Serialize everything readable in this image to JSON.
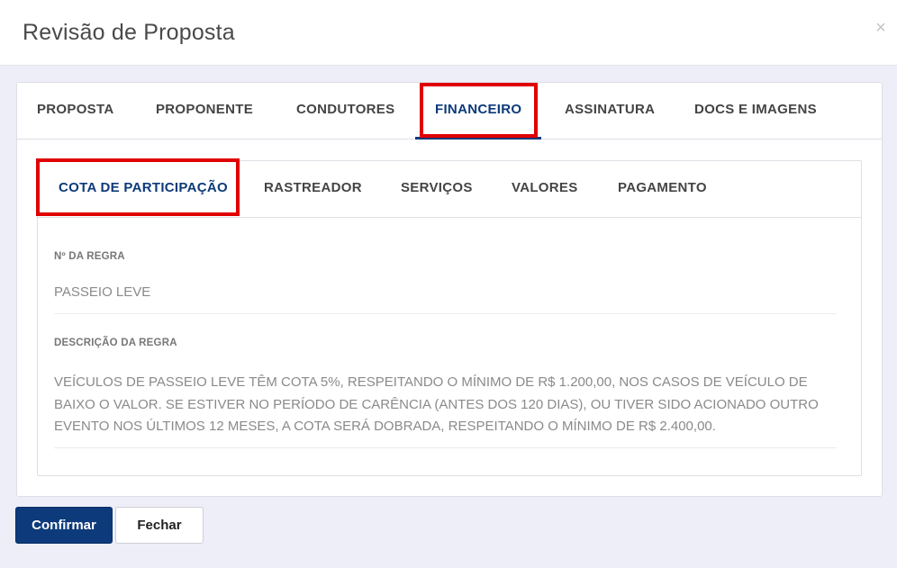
{
  "modal": {
    "title": "Revisão de Proposta",
    "close_label": "×"
  },
  "outer_tabs": [
    {
      "label": "PROPOSTA"
    },
    {
      "label": "PROPONENTE"
    },
    {
      "label": "CONDUTORES"
    },
    {
      "label": "FINANCEIRO",
      "active": true
    },
    {
      "label": "ASSINATURA"
    },
    {
      "label": "DOCS E IMAGENS"
    }
  ],
  "inner_tabs": [
    {
      "label": "COTA DE PARTICIPAÇÃO",
      "active": true
    },
    {
      "label": "RASTREADOR"
    },
    {
      "label": "SERVIÇOS"
    },
    {
      "label": "VALORES"
    },
    {
      "label": "PAGAMENTO"
    }
  ],
  "fields": {
    "rule_number": {
      "label": "Nº DA REGRA",
      "value": "PASSEIO LEVE"
    },
    "rule_description": {
      "label": "DESCRIÇÃO DA REGRA",
      "value": "VEÍCULOS DE PASSEIO LEVE TÊM COTA 5%, RESPEITANDO O MÍNIMO DE R$ 1.200,00, NOS CASOS DE VEÍCULO DE BAIXO O VALOR. SE ESTIVER NO PERÍODO DE CARÊNCIA (ANTES DOS 120 DIAS), OU TIVER SIDO ACIONADO OUTRO EVENTO NOS ÚLTIMOS 12 MESES, A COTA SERÁ DOBRADA, RESPEITANDO O MÍNIMO DE R$ 2.400,00."
    }
  },
  "footer": {
    "confirm_label": "Confirmar",
    "close_label": "Fechar"
  },
  "colors": {
    "primary": "#0d3a7a",
    "highlight": "#e00000",
    "backdrop": "#eeeef8"
  }
}
